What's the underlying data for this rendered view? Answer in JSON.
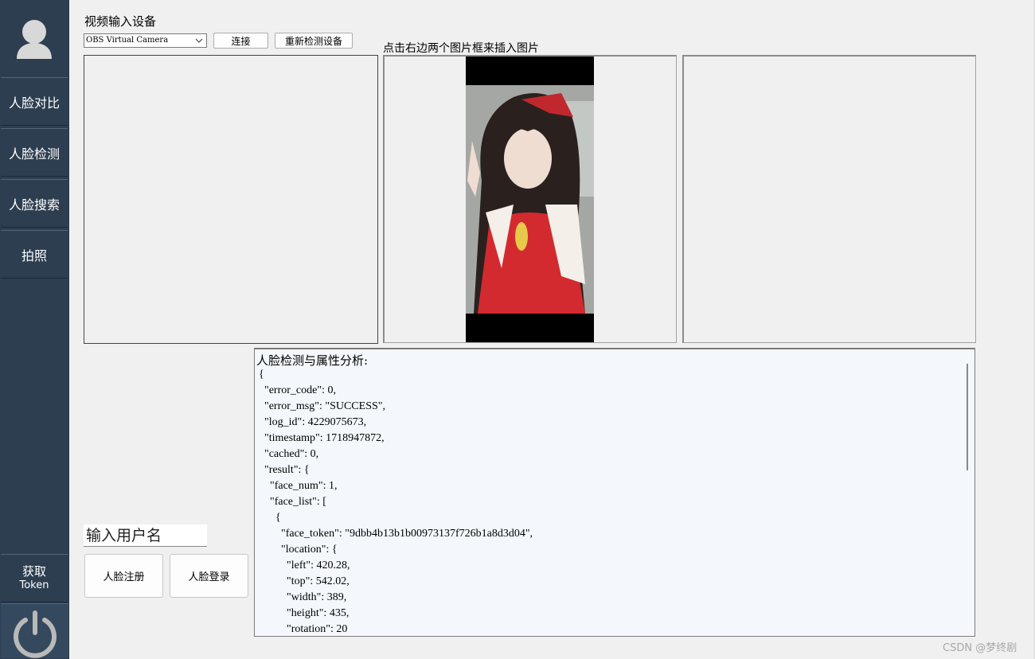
{
  "sidebar": {
    "items": [
      {
        "label": "人脸对比"
      },
      {
        "label": "人脸检测"
      },
      {
        "label": "人脸搜索"
      },
      {
        "label": "拍照"
      }
    ],
    "token_button": {
      "line1": "获取",
      "line2": "Token"
    }
  },
  "video": {
    "device_label": "视频输入设备",
    "selected_device": "OBS Virtual Camera",
    "connect_label": "连接",
    "redetect_label": "重新检测设备"
  },
  "images": {
    "hint": "点击右边两个图片框来插入图片"
  },
  "output": {
    "header": "人脸检测与属性分析:",
    "lines": [
      "{",
      "  \"error_code\": 0,",
      "  \"error_msg\": \"SUCCESS\",",
      "  \"log_id\": 4229075673,",
      "  \"timestamp\": 1718947872,",
      "  \"cached\": 0,",
      "  \"result\": {",
      "    \"face_num\": 1,",
      "    \"face_list\": [",
      "      {",
      "        \"face_token\": \"9dbb4b13b1b00973137f726b1a8d3d04\",",
      "        \"location\": {",
      "          \"left\": 420.28,",
      "          \"top\": 542.02,",
      "          \"width\": 389,",
      "          \"height\": 435,",
      "          \"rotation\": 20"
    ]
  },
  "login": {
    "username_placeholder": "输入用户名",
    "register_label": "人脸注册",
    "login_label": "人脸登录"
  },
  "watermark": "CSDN @梦终剧",
  "colors": {
    "sidebar_bg": "#2c3e50",
    "window_bg": "#f0f0f0",
    "output_bg": "#f4f7fb"
  },
  "icons": {
    "avatar": "user-avatar-icon",
    "power": "power-icon",
    "select_arrow": "chevron-down-icon"
  }
}
